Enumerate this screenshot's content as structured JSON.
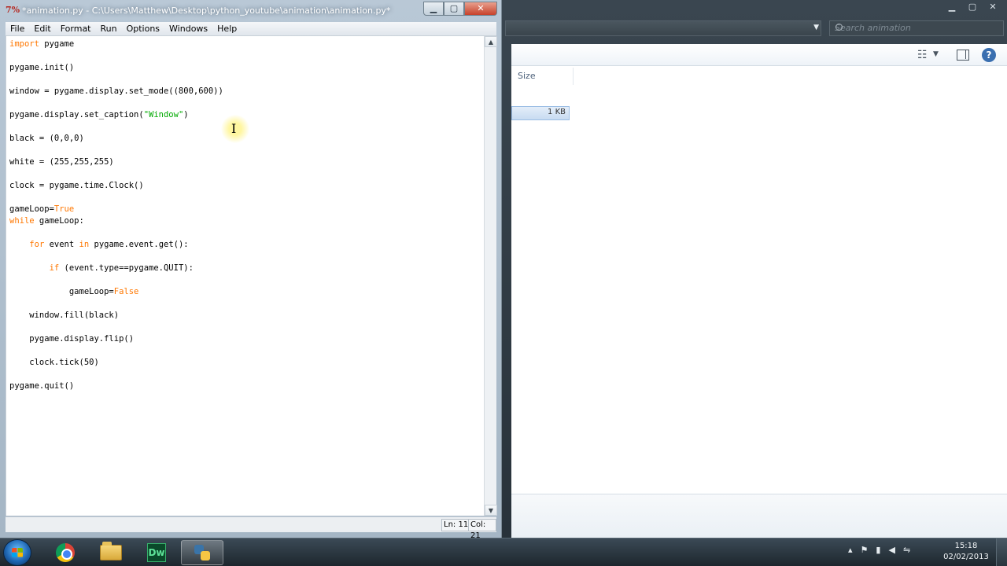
{
  "idle": {
    "title": "*animation.py - C:\\Users\\Matthew\\Desktop\\python_youtube\\animation\\animation.py*",
    "app_icon": "7%",
    "menu": [
      "File",
      "Edit",
      "Format",
      "Run",
      "Options",
      "Windows",
      "Help"
    ],
    "status": {
      "line": "Ln: 11",
      "col": "Col: 21"
    },
    "code": [
      {
        "parts": [
          [
            "kw",
            "import"
          ],
          [
            "",
            " pygame"
          ]
        ]
      },
      {
        "parts": [
          [
            "",
            "pygame.init()"
          ]
        ]
      },
      {
        "parts": [
          [
            "",
            "window = pygame.display.set_mode((800,600))"
          ]
        ]
      },
      {
        "parts": [
          [
            "",
            "pygame.display.set_caption("
          ],
          [
            "str",
            "\"Window\""
          ],
          [
            "",
            ")"
          ]
        ]
      },
      {
        "parts": [
          [
            "",
            "black = (0,0,0)"
          ]
        ]
      },
      {
        "parts": [
          [
            "",
            "white = (255,255,255)"
          ]
        ]
      },
      {
        "parts": [
          [
            "",
            "clock = pygame.time.Clock()"
          ]
        ]
      },
      {
        "parts": [
          [
            "",
            "gameLoop="
          ],
          [
            "kw",
            "True"
          ]
        ]
      },
      {
        "parts": [
          [
            "kw",
            "while"
          ],
          [
            "",
            " gameLoop:"
          ]
        ]
      },
      {
        "parts": [
          [
            "",
            "    "
          ],
          [
            "kw",
            "for"
          ],
          [
            "",
            " event "
          ],
          [
            "kw",
            "in"
          ],
          [
            "",
            " pygame.event.get():"
          ]
        ]
      },
      {
        "parts": [
          [
            "",
            "        "
          ],
          [
            "kw",
            "if"
          ],
          [
            "",
            " (event.type==pygame.QUIT):"
          ]
        ]
      },
      {
        "parts": [
          [
            "",
            "            gameLoop="
          ],
          [
            "kw",
            "False"
          ]
        ]
      },
      {
        "parts": [
          [
            "",
            "    window.fill(black)"
          ]
        ]
      },
      {
        "parts": [
          [
            "",
            "    pygame.display.flip()"
          ]
        ]
      },
      {
        "parts": [
          [
            "",
            "    clock.tick(50)"
          ]
        ]
      },
      {
        "parts": [
          [
            "",
            "pygame.quit()"
          ]
        ]
      }
    ]
  },
  "explorer": {
    "search_placeholder": "Search animation",
    "column_size": "Size",
    "file_size": "1 KB"
  },
  "taskbar": {
    "dw_label": "Dw",
    "clock_time": "15:18",
    "clock_date": "02/02/2013"
  },
  "icons": {
    "start": "windows-start-icon",
    "chrome": "chrome-icon",
    "explorer": "folder-icon",
    "dreamweaver": "dreamweaver-icon",
    "python": "python-icon"
  }
}
